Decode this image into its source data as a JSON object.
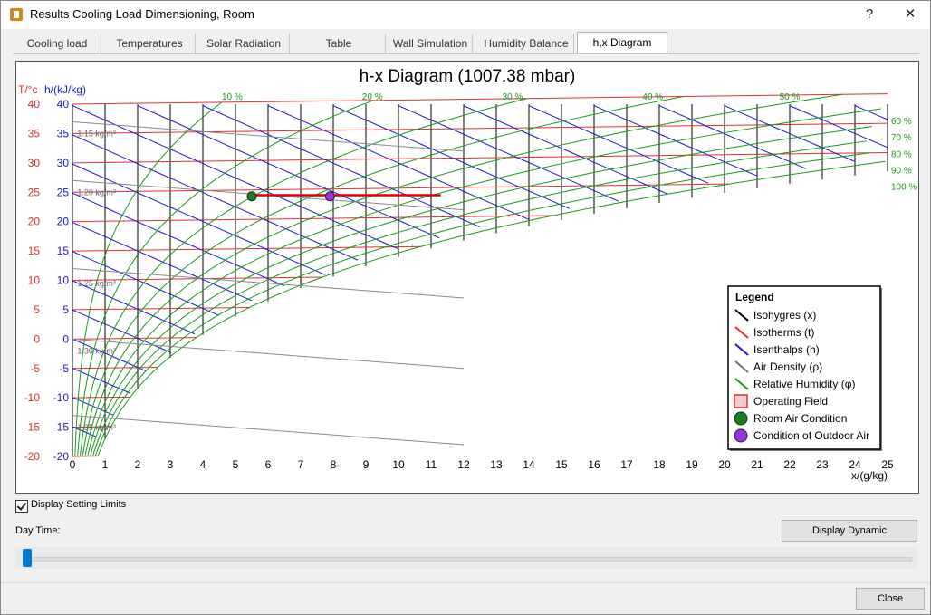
{
  "window": {
    "title": "Results Cooling Load Dimensioning, Room",
    "help_label": "?",
    "close_label": "✕"
  },
  "tabs": [
    {
      "label": "Cooling load",
      "active": false
    },
    {
      "label": "Temperatures",
      "active": false
    },
    {
      "label": "Solar Radiation",
      "active": false
    },
    {
      "label": "Table",
      "active": false
    },
    {
      "label": "Wall Simulation",
      "active": false
    },
    {
      "label": "Humidity Balance",
      "active": false
    },
    {
      "label": "h,x Diagram",
      "active": true
    }
  ],
  "chart_data": {
    "type": "line",
    "title": "h-x Diagram (1007.38 mbar)",
    "xlabel": "x/(g/kg)",
    "ylabel_t": "T/°c",
    "ylabel_h": "h/(kJ/kg)",
    "xlim": [
      0,
      25
    ],
    "ylim": [
      -20,
      40
    ],
    "x_ticks": [
      "0",
      "1",
      "2",
      "3",
      "4",
      "5",
      "6",
      "7",
      "8",
      "9",
      "10",
      "11",
      "12",
      "13",
      "14",
      "15",
      "16",
      "17",
      "18",
      "19",
      "20",
      "21",
      "22",
      "23",
      "24",
      "25"
    ],
    "t_ticks": [
      "40",
      "35",
      "30",
      "25",
      "20",
      "15",
      "10",
      "5",
      "0",
      "-5",
      "-10",
      "-15",
      "-20"
    ],
    "h_ticks": [
      "40",
      "35",
      "30",
      "25",
      "20",
      "15",
      "10",
      "5",
      "0",
      "-5",
      "-10",
      "-15",
      "-20"
    ],
    "rh_labels": [
      "10 %",
      "20 %",
      "30 %",
      "40 %",
      "50 %",
      "60 %",
      "70 %",
      "80 %",
      "90 %",
      "100 %"
    ],
    "density_labels": [
      "1.15 kg/m³",
      "1.20 kg/m³",
      "1.25 kg/m³",
      "1.30 kg/m³",
      "1.35 kg/m³"
    ],
    "operating_field": {
      "x": [
        5.5,
        11.3
      ],
      "t": 24.5
    },
    "points": [
      {
        "name": "Room Air Condition",
        "x": 5.5,
        "t": 24.3,
        "color": "#1a7f1a"
      },
      {
        "name": "Condition of Outdoor Air",
        "x": 7.9,
        "t": 24.3,
        "color": "#9b30e0"
      }
    ],
    "legend": {
      "title": "Legend",
      "position": "bottom-right",
      "items": [
        {
          "label": "Isohygres (x)",
          "color": "#000000",
          "kind": "line"
        },
        {
          "label": "Isotherms (t)",
          "color": "#e03030",
          "kind": "line"
        },
        {
          "label": "Isenthalps (h)",
          "color": "#1a1ad0",
          "kind": "line"
        },
        {
          "label": "Air Density (ρ)",
          "color": "#707070",
          "kind": "line"
        },
        {
          "label": "Relative Humidity (φ)",
          "color": "#1a9a1a",
          "kind": "line"
        },
        {
          "label": "Operating Field",
          "color": "#e03030",
          "kind": "box"
        },
        {
          "label": "Room Air Condition",
          "color": "#1a7f1a",
          "kind": "dot"
        },
        {
          "label": "Condition of Outdoor Air",
          "color": "#9b30e0",
          "kind": "dot"
        }
      ]
    }
  },
  "controls": {
    "display_limits_label": "Display Setting Limits",
    "display_limits_checked": true,
    "day_time_label": "Day Time:",
    "display_dynamic_label": "Display Dynamic",
    "slider_value": 0
  },
  "footer": {
    "close_label": "Close"
  }
}
